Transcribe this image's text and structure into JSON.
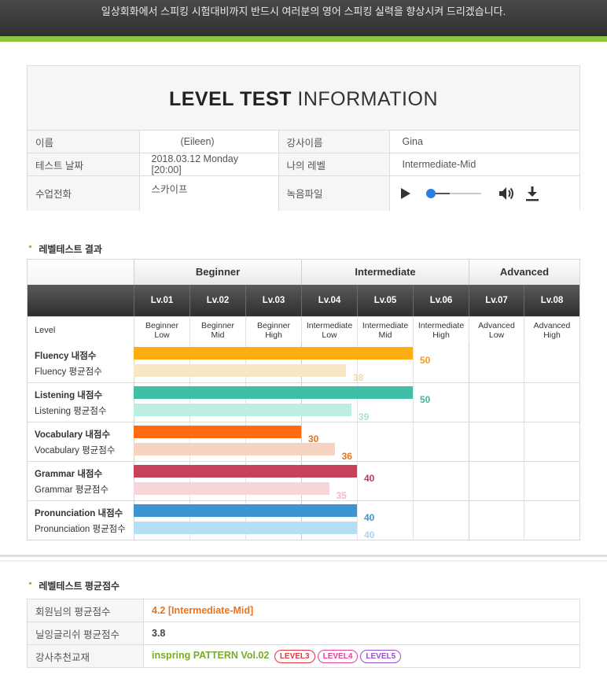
{
  "banner": "일상회화에서 스피킹 시험대비까지 반드시 여러분의 영어 스피킹 실력을 향상시켜 드리겠습니다.",
  "info": {
    "title_bold": "LEVEL TEST",
    "title_light": "INFORMATION",
    "name_label": "이름",
    "name_value": "(Eileen)",
    "teacher_label": "강사이름",
    "teacher_value": "Gina",
    "date_label": "테스트 날짜",
    "date_value": "2018.03.12  Monday [20:00]",
    "mylevel_label": "나의 레벨",
    "mylevel_value": "Intermediate-Mid",
    "phone_label": "수업전화",
    "phone_value": "스카이프",
    "record_label": "녹음파일",
    "audio_progress": 0.0
  },
  "result": {
    "section_title": "레벨테스트 결과",
    "groups": [
      "Beginner",
      "Intermediate",
      "Advanced"
    ],
    "levels": [
      "Lv.01",
      "Lv.02",
      "Lv.03",
      "Lv.04",
      "Lv.05",
      "Lv.06",
      "Lv.07",
      "Lv.08"
    ],
    "level_row_label": "Level",
    "level_names": [
      [
        "Beginner",
        "Low"
      ],
      [
        "Beginner",
        "Mid"
      ],
      [
        "Beginner",
        "High"
      ],
      [
        "Intermediate",
        "Low"
      ],
      [
        "Intermediate",
        "Mid"
      ],
      [
        "Intermediate",
        "High"
      ],
      [
        "Advanced",
        "Low"
      ],
      [
        "Advanced",
        "High"
      ]
    ]
  },
  "chart_data": {
    "type": "bar",
    "max_value": 80,
    "series": [
      {
        "name": "Fluency 내점수",
        "avg_name": "Fluency 평균점수",
        "mine": 50,
        "avg": 38,
        "color": "#ffae12",
        "avg_color": "#f8e6c4"
      },
      {
        "name": "Listening 내점수",
        "avg_name": "Listening 평균점수",
        "mine": 50,
        "avg": 39,
        "color": "#3fbfa7",
        "avg_color": "#bdeee4"
      },
      {
        "name": "Vocabulary 내점수",
        "avg_name": "Vocabulary 평균점수",
        "mine": 30,
        "avg": 36,
        "color": "#ff6a12",
        "avg_color": "#f7d3c2"
      },
      {
        "name": "Grammar 내점수",
        "avg_name": "Grammar 평균점수",
        "mine": 40,
        "avg": 35,
        "color": "#c8405a",
        "avg_color": "#f7d6da"
      },
      {
        "name": "Pronunciation 내점수",
        "avg_name": "Pronunciation 평균점수",
        "mine": 40,
        "avg": 40,
        "color": "#3b95d0",
        "avg_color": "#b6def4"
      }
    ],
    "mine_label_colors": [
      "#f39c12",
      "#3fb8a0",
      "#e8731d",
      "#c03a55",
      "#3b95d0"
    ],
    "avg_label_colors": [
      "#f3d9a8",
      "#a5e2d6",
      "#e8731d",
      "#f2b9c4",
      "#a9d6f0"
    ]
  },
  "average": {
    "section_title": "레벨테스트 평균점수",
    "member_label": "회원님의 평균점수",
    "member_value": "4.2 [Intermediate-Mid]",
    "nailing_label": "닐잉글리쉬 평균점수",
    "nailing_value": "3.8",
    "book_label": "강사추천교재",
    "book_value": "inspring PATTERN Vol.02",
    "badges": [
      {
        "label": "LEVEL3",
        "color": "#e8373f"
      },
      {
        "label": "LEVEL4",
        "color": "#e83f9a"
      },
      {
        "label": "LEVEL5",
        "color": "#9b4fc8"
      }
    ]
  }
}
